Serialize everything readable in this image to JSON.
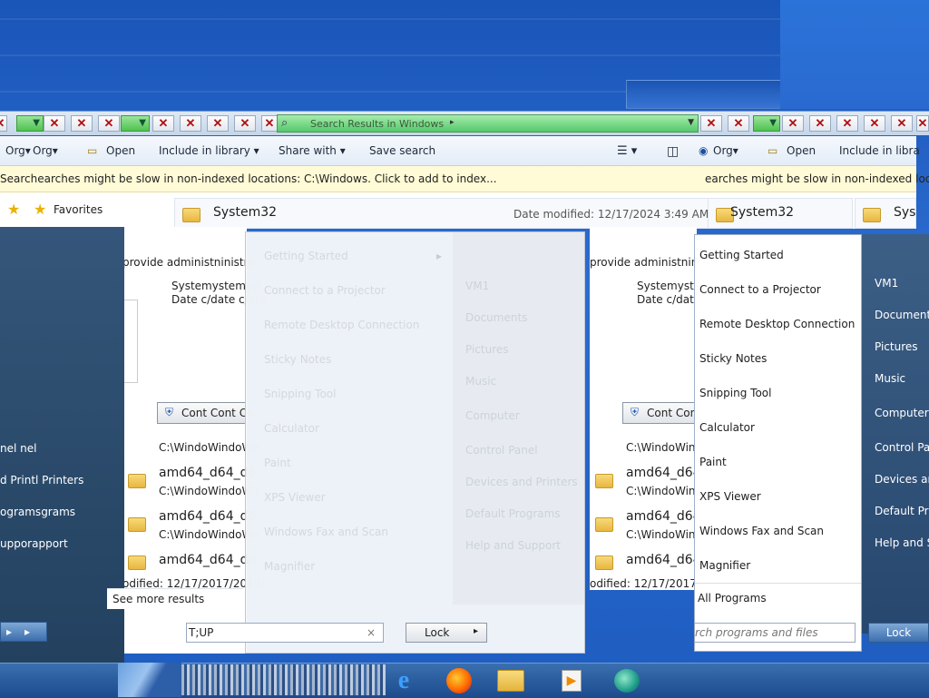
{
  "window": {
    "address_text": "Search Results in Windows",
    "toolbar": {
      "organize_labels": [
        "Org▾",
        "Org▾",
        "Org▾"
      ],
      "open_label": "Open",
      "include_label": "Include in library ▾",
      "include_label_right": "Include in libra",
      "share_label": "Share with ▾",
      "save_search_label": "Save search"
    },
    "infobar_text": "Searchearches might be slow in non-indexed locations: C:\\Windows. Click to add to index...",
    "infobar_text_right": "earches might be slow in non-indexed loca",
    "favorites_label": "Favorites",
    "results": {
      "system32_name": "System32",
      "date_modified": "Date modified: 12/17/2024 3:49 AM",
      "provide_admin": "provide administninistnin",
      "provide_admin_right": "provide administninistnin",
      "system_line": "Systemystemyst",
      "date_line": "Date c/date c/ate",
      "continue_label": "Cont Cont Co",
      "continue_label_right": "Cont Cont",
      "path_text": "C:\\WindoWindoWir",
      "amd_text": "amd64_d64_d6",
      "modified_text": "odified: 12/17/2017/2017/",
      "see_more": "See more results"
    }
  },
  "left_dark": {
    "items": [
      "nel   nel",
      "d Printl Printers",
      "ogramsgrams",
      "upporapport"
    ]
  },
  "ghost_menu": {
    "left_items": [
      "Getting Started",
      "Connect to a Projector",
      "Remote Desktop Connection",
      "Sticky Notes",
      "Snipping Tool",
      "Calculator",
      "Paint",
      "XPS Viewer",
      "Windows Fax and Scan",
      "Magnifier"
    ],
    "right_items": [
      "VM1",
      "Documents",
      "Pictures",
      "Music",
      "Computer",
      "Control Panel",
      "Devices and Printers",
      "Default Programs",
      "Help and Support"
    ],
    "search_value": "T;UP",
    "lock_label": "Lock"
  },
  "start_menu": {
    "items": [
      "Getting Started",
      "Connect to a Projector",
      "Remote Desktop Connection",
      "Sticky Notes",
      "Snipping Tool",
      "Calculator",
      "Paint",
      "XPS Viewer",
      "Windows Fax and Scan",
      "Magnifier"
    ],
    "all_programs": "All Programs",
    "search_placeholder": "rch programs and files",
    "right_items": [
      "VM1",
      "Documents",
      "Pictures",
      "Music",
      "Computer",
      "Control Par",
      "Devices and",
      "Default Pro",
      "Help and Su"
    ],
    "lock_label": "Lock"
  },
  "taskbar": {
    "icons": [
      "ie-icon",
      "firefox-icon",
      "explorer-icon",
      "media-player-icon",
      "chat-icon"
    ]
  }
}
